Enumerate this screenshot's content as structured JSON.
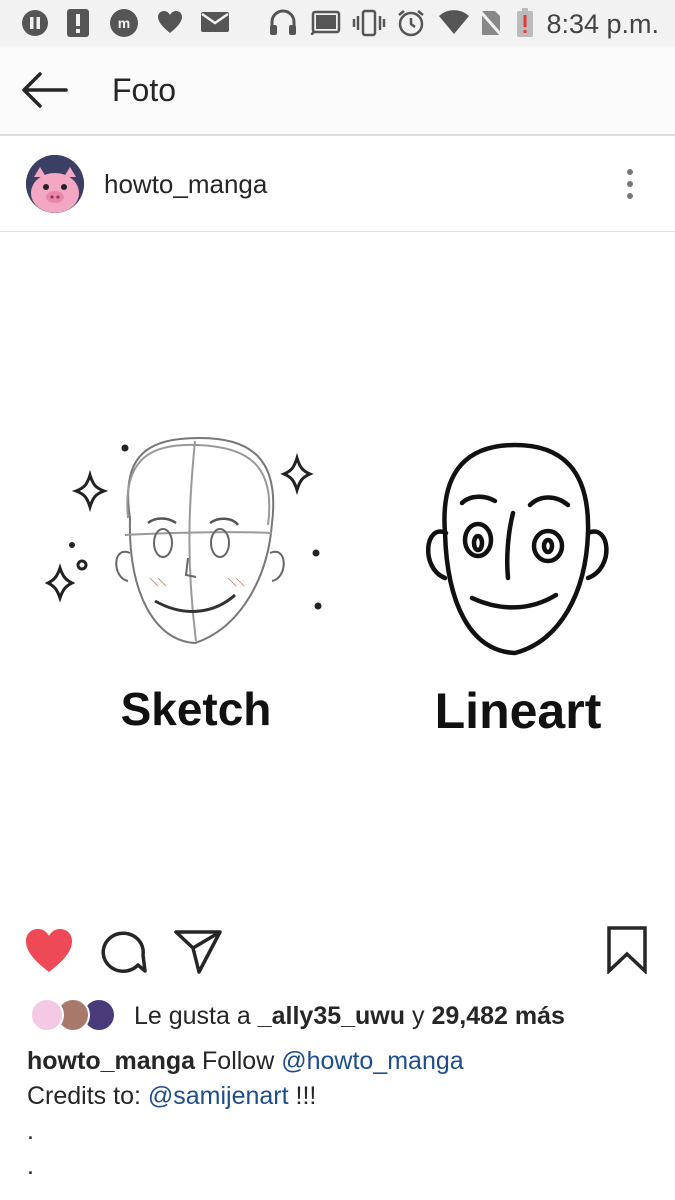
{
  "status_bar": {
    "time": "8:34 p.m.",
    "icons": [
      "pause-circle-icon",
      "alert-icon",
      "messenger-icon",
      "heart-notification-icon",
      "mail-icon",
      "headphones-icon",
      "cast-icon",
      "vibrate-icon",
      "alarm-icon",
      "wifi-icon",
      "no-sim-icon",
      "battery-low-icon"
    ]
  },
  "app_bar": {
    "title": "Foto",
    "back_icon": "arrow-left-icon"
  },
  "post": {
    "username": "howto_manga",
    "more_icon": "more-vertical-icon",
    "image": {
      "left_label": "Sketch",
      "right_label": "Lineart"
    }
  },
  "actions": {
    "like_icon": "heart-filled-icon",
    "comment_icon": "comment-icon",
    "share_icon": "send-icon",
    "save_icon": "bookmark-icon",
    "like_color": "#ed4956"
  },
  "likes": {
    "prefix": "Le gusta a ",
    "user": "_ally35_uwu",
    "middle": " y ",
    "count": "29,482 más"
  },
  "caption": {
    "username": "howto_manga",
    "line1_text": " Follow ",
    "line1_mention": "@howto_manga",
    "line2_text": "Credits to: ",
    "line2_mention": "@samijenart",
    "line2_suffix": " !!!",
    "dot1": ".",
    "dot2": "."
  }
}
